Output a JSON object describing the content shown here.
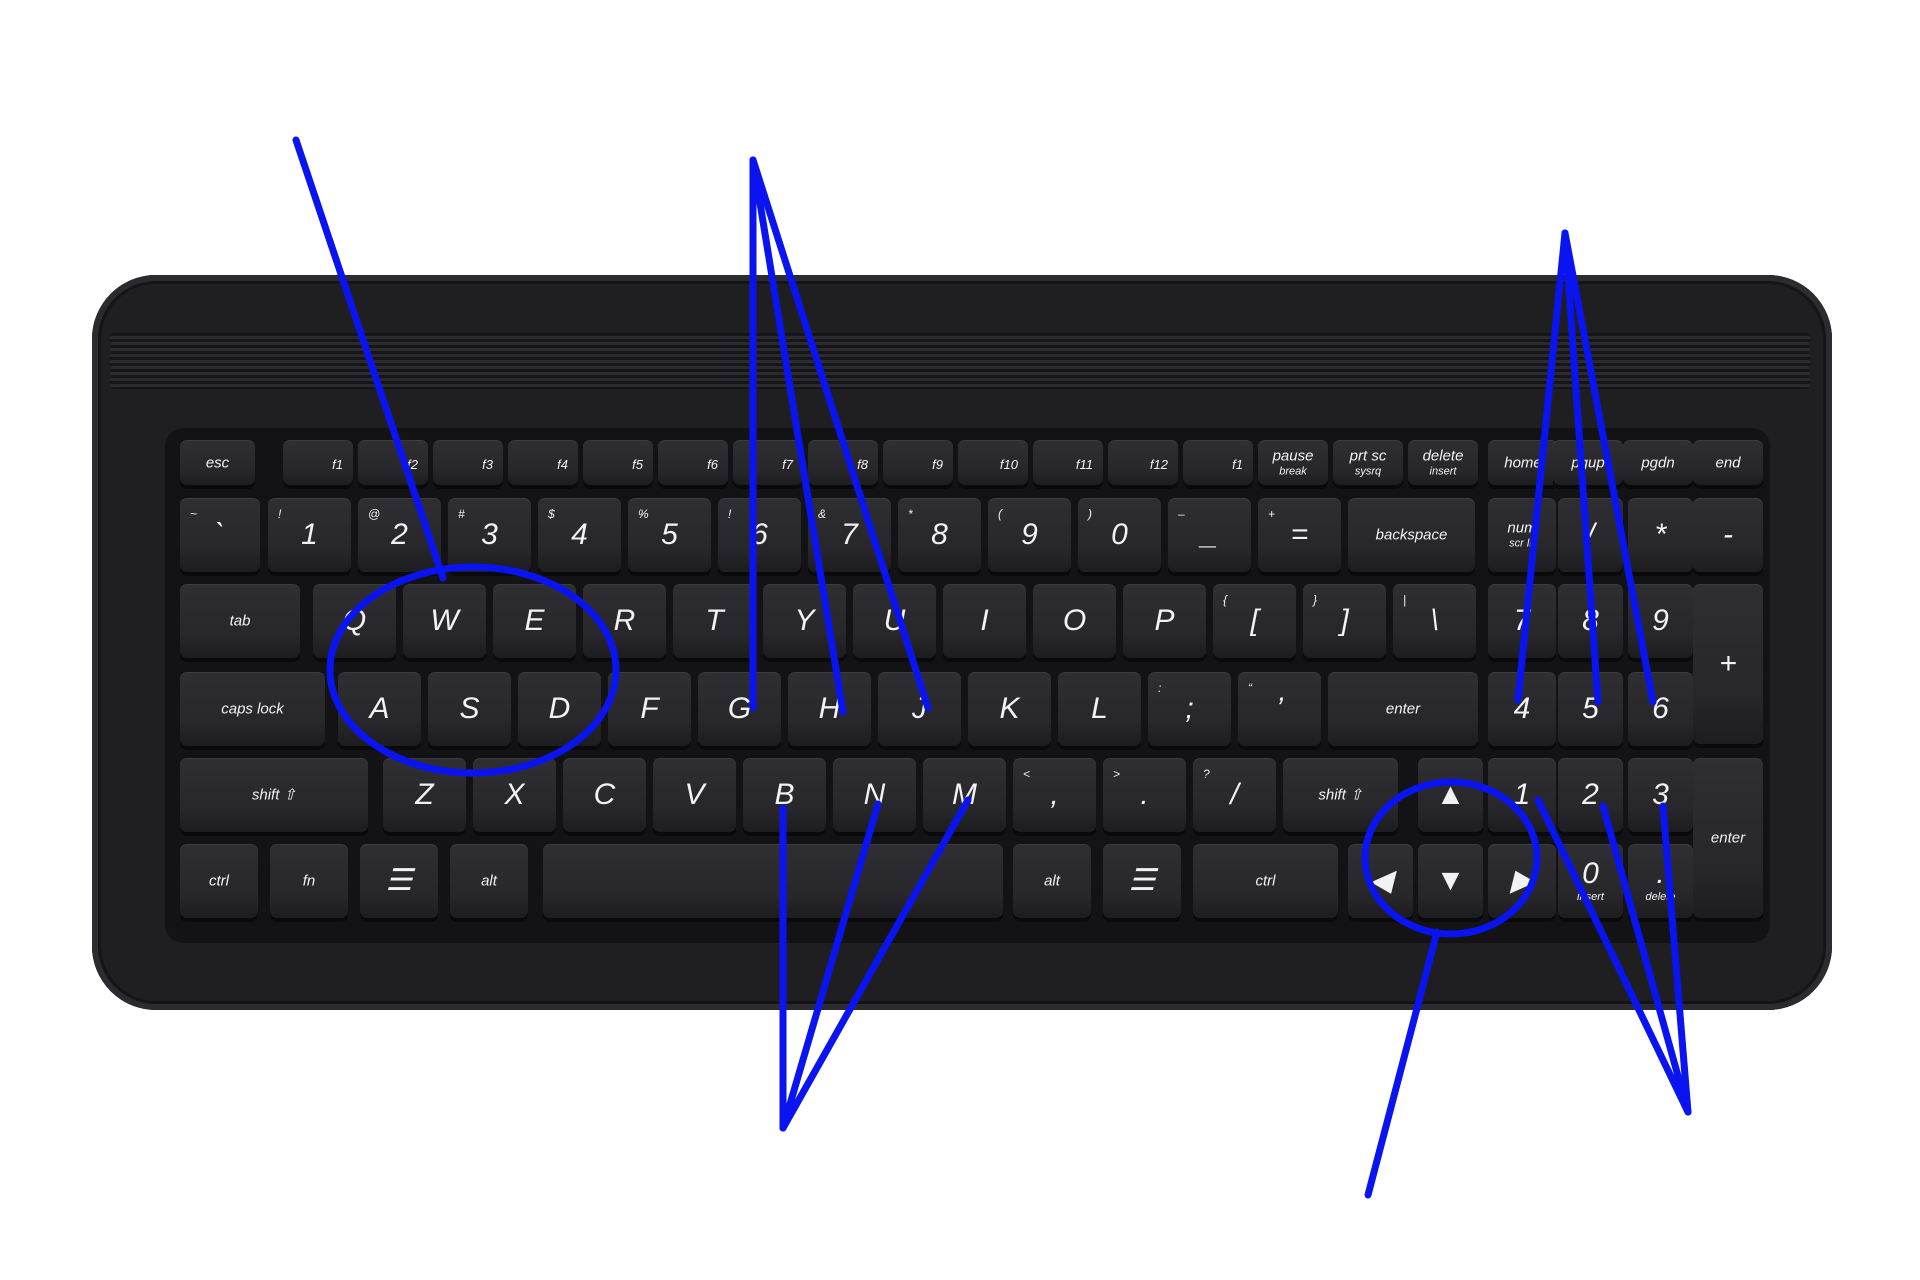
{
  "colors": {
    "annotation": "#0a14f0",
    "keyboard_body": "#1f1f22",
    "key_face": "#2b2b2f",
    "key_legend": "#f2f2f2"
  },
  "icon_names": [
    "menu-icon",
    "arrow-up-icon",
    "arrow-down-icon",
    "arrow-left-icon",
    "arrow-right-icon",
    "shift-icon",
    "tab-icon",
    "enter-icon",
    "backspace-icon"
  ],
  "rows": [
    {
      "name": "function-row",
      "keys": [
        {
          "label": "esc"
        },
        {
          "label": "f1"
        },
        {
          "label": "f2"
        },
        {
          "label": "f3"
        },
        {
          "label": "f4"
        },
        {
          "label": "f5"
        },
        {
          "label": "f6"
        },
        {
          "label": "f7"
        },
        {
          "label": "f8"
        },
        {
          "label": "f9"
        },
        {
          "label": "f10"
        },
        {
          "label": "f11"
        },
        {
          "label": "f12"
        },
        {
          "label": "f1"
        },
        {
          "label": "pause",
          "label2": "break"
        },
        {
          "label": "prt sc",
          "label2": "sysrq"
        },
        {
          "label": "delete",
          "label2": "insert"
        },
        {
          "label": "home"
        },
        {
          "label": "pgup"
        },
        {
          "label": "pgdn"
        },
        {
          "label": "end"
        }
      ]
    },
    {
      "name": "number-row",
      "keys": [
        {
          "label": "`",
          "shift": "~"
        },
        {
          "label": "1",
          "shift": "!"
        },
        {
          "label": "2",
          "shift": "@"
        },
        {
          "label": "3",
          "shift": "#"
        },
        {
          "label": "4",
          "shift": "$"
        },
        {
          "label": "5",
          "shift": "%"
        },
        {
          "label": "6",
          "shift": "!"
        },
        {
          "label": "7",
          "shift": "&"
        },
        {
          "label": "8",
          "shift": "*"
        },
        {
          "label": "9",
          "shift": "("
        },
        {
          "label": "0",
          "shift": ")"
        },
        {
          "label": "_",
          "shift": "–"
        },
        {
          "label": "=",
          "shift": "+"
        },
        {
          "label": "backspace"
        },
        {
          "label": "num",
          "label2": "scr lk"
        },
        {
          "label": "/"
        },
        {
          "label": "*"
        },
        {
          "label": "-"
        }
      ]
    },
    {
      "name": "qwerty-row",
      "keys": [
        {
          "label": "tab"
        },
        {
          "label": "Q"
        },
        {
          "label": "W"
        },
        {
          "label": "E"
        },
        {
          "label": "R"
        },
        {
          "label": "T"
        },
        {
          "label": "Y"
        },
        {
          "label": "U"
        },
        {
          "label": "I"
        },
        {
          "label": "O"
        },
        {
          "label": "P"
        },
        {
          "label": "[",
          "shift": "{"
        },
        {
          "label": "]",
          "shift": "}"
        },
        {
          "label": "\\",
          "shift": "|"
        },
        {
          "label": "7"
        },
        {
          "label": "8"
        },
        {
          "label": "9"
        },
        {
          "label": "+"
        }
      ]
    },
    {
      "name": "home-row",
      "keys": [
        {
          "label": "caps lock"
        },
        {
          "label": "A"
        },
        {
          "label": "S"
        },
        {
          "label": "D"
        },
        {
          "label": "F"
        },
        {
          "label": "G"
        },
        {
          "label": "H"
        },
        {
          "label": "J"
        },
        {
          "label": "K"
        },
        {
          "label": "L"
        },
        {
          "label": ";",
          "shift": ":"
        },
        {
          "label": "’",
          "shift": "“"
        },
        {
          "label": "enter"
        },
        {
          "label": "4"
        },
        {
          "label": "5"
        },
        {
          "label": "6"
        }
      ]
    },
    {
      "name": "shift-row",
      "keys": [
        {
          "label": "shift ⇧"
        },
        {
          "label": "Z"
        },
        {
          "label": "X"
        },
        {
          "label": "C"
        },
        {
          "label": "V"
        },
        {
          "label": "B"
        },
        {
          "label": "N"
        },
        {
          "label": "M"
        },
        {
          "label": ",",
          "shift": "<"
        },
        {
          "label": ".",
          "shift": ">"
        },
        {
          "label": "/",
          "shift": "?"
        },
        {
          "label": "shift ⇧"
        },
        {
          "label": "▲"
        },
        {
          "label": "1"
        },
        {
          "label": "2"
        },
        {
          "label": "3"
        },
        {
          "label": "enter"
        }
      ]
    },
    {
      "name": "bottom-row",
      "keys": [
        {
          "label": "ctrl"
        },
        {
          "label": "fn"
        },
        {
          "label": "☰"
        },
        {
          "label": "alt"
        },
        {
          "label": ""
        },
        {
          "label": "alt"
        },
        {
          "label": "☰"
        },
        {
          "label": "ctrl"
        },
        {
          "label": "◀"
        },
        {
          "label": "▼"
        },
        {
          "label": "▶"
        },
        {
          "label": "0",
          "label2": "insert"
        },
        {
          "label": ".",
          "label2": "delete"
        }
      ]
    }
  ]
}
